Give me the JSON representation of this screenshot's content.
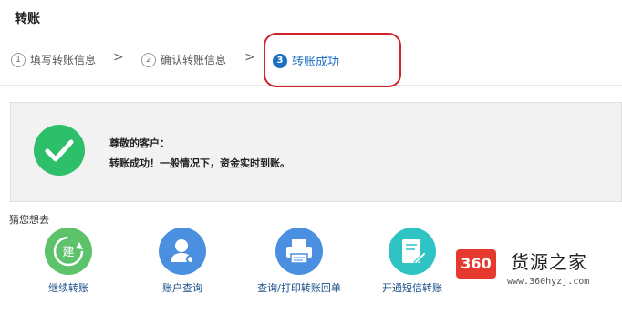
{
  "header": {
    "title": "转账"
  },
  "steps": [
    {
      "num": "1",
      "label": "填写转账信息",
      "active": false
    },
    {
      "num": "2",
      "label": "确认转账信息",
      "active": false
    },
    {
      "num": "3",
      "label": "转账成功",
      "active": true
    }
  ],
  "step_separator": ">",
  "banner": {
    "greeting": "尊敬的客户：",
    "message": "转账成功！一般情况下，资金实时到账。"
  },
  "suggest": {
    "title": "猜您想去",
    "actions": [
      {
        "label": "继续转账",
        "icon": "continue-transfer-icon",
        "color": "#5cc36b",
        "glyph": "建"
      },
      {
        "label": "账户查询",
        "icon": "account-query-icon",
        "color": "#4a8fe0"
      },
      {
        "label": "查询/打印转账回单",
        "icon": "printer-icon",
        "color": "#4a8fe0"
      },
      {
        "label": "开通短信转账",
        "icon": "sms-transfer-icon",
        "color": "#2fc3c3"
      }
    ]
  },
  "watermark": {
    "logo": "360",
    "name": "货源之家",
    "url": "www.360hyzj.com"
  },
  "colors": {
    "accent": "#1b6fc2",
    "success": "#2dbf6a",
    "highlight": "#d2222c"
  }
}
